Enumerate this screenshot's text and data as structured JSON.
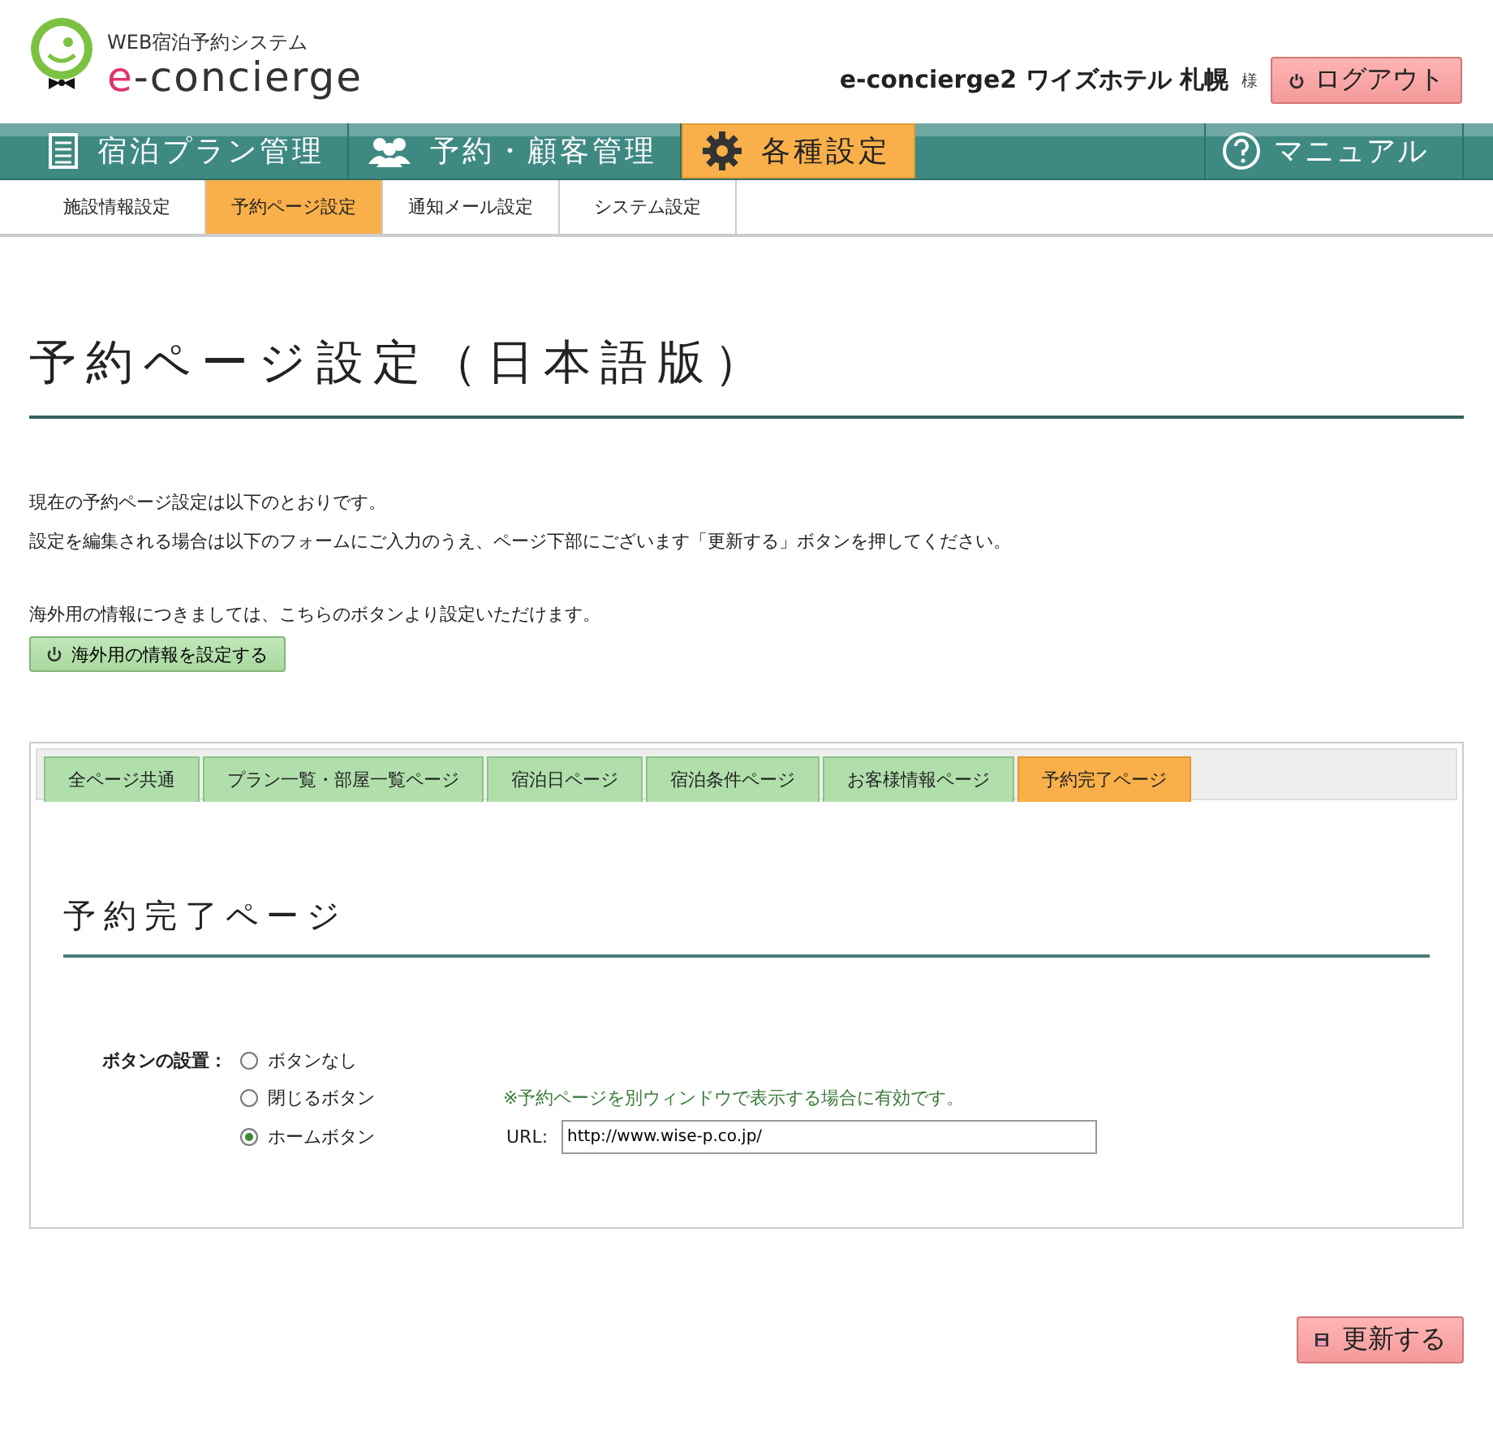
{
  "header": {
    "system_name": "WEB宿泊予約システム",
    "logo_text": "e-concierge",
    "account": "e-concierge2 ワイズホテル 札幌",
    "honorific": "様",
    "logout_button": "ログアウト"
  },
  "main_nav": {
    "items": [
      {
        "label": "宿泊プラン管理",
        "selected": false
      },
      {
        "label": "予約・顧客管理",
        "selected": false
      },
      {
        "label": "各種設定",
        "selected": true
      }
    ],
    "manual": "マニュアル"
  },
  "sub_nav": [
    {
      "label": "施設情報設定",
      "selected": false
    },
    {
      "label": "予約ページ設定",
      "selected": true
    },
    {
      "label": "通知メール設定",
      "selected": false
    },
    {
      "label": "システム設定",
      "selected": false
    }
  ],
  "page_title": "予約ページ設定（日本語版）",
  "intro": [
    "現在の予約ページ設定は以下のとおりです。",
    "設定を編集される場合は以下のフォームにご入力のうえ、ページ下部にございます「更新する」ボタンを押してください。"
  ],
  "overseas_note": "海外用の情報につきましては、こちらのボタンより設定いただけます。",
  "overseas_button": "海外用の情報を設定する",
  "tabs": [
    {
      "label": "全ページ共通",
      "selected": false
    },
    {
      "label": "プラン一覧・部屋一覧ページ",
      "selected": false
    },
    {
      "label": "宿泊日ページ",
      "selected": false
    },
    {
      "label": "宿泊条件ページ",
      "selected": false
    },
    {
      "label": "お客様情報ページ",
      "selected": false
    },
    {
      "label": "予約完了ページ",
      "selected": true
    }
  ],
  "section_title": "予約完了ページ",
  "form": {
    "label": "ボタンの設置：",
    "options": [
      {
        "label": "ボタンなし",
        "selected": false
      },
      {
        "label": "閉じるボタン",
        "selected": false,
        "note": "※予約ページを別ウィンドウで表示する場合に有効です。"
      },
      {
        "label": "ホームボタン",
        "selected": true,
        "url_label": "URL:",
        "url_value": "http://www.wise-p.co.jp/"
      }
    ]
  },
  "update_button": "更新する"
}
